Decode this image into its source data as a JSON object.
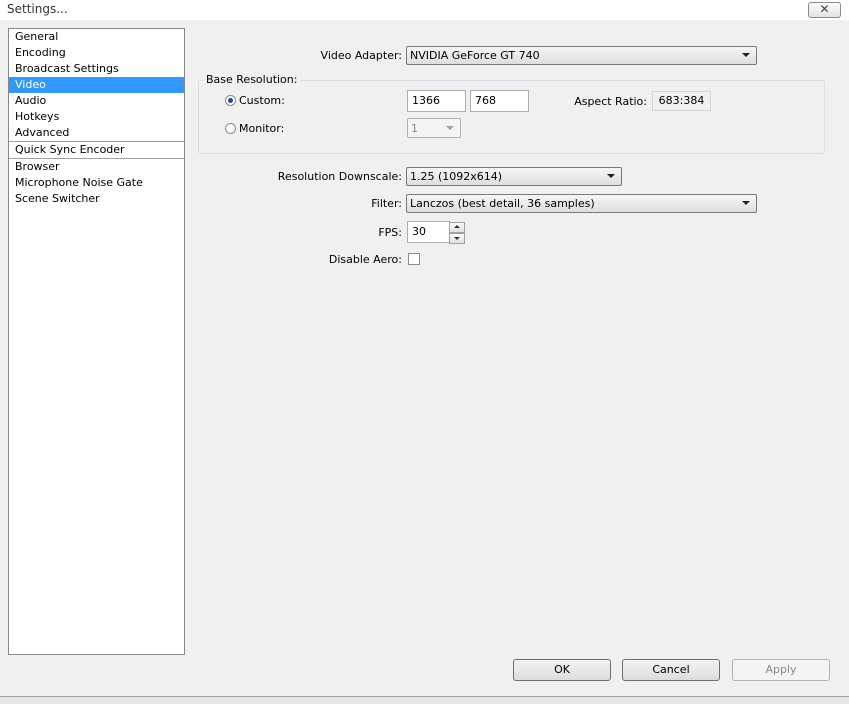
{
  "window": {
    "title": "Settings..."
  },
  "sidebar": {
    "items": [
      {
        "label": "General"
      },
      {
        "label": "Encoding"
      },
      {
        "label": "Broadcast Settings"
      },
      {
        "label": "Video",
        "selected": true
      },
      {
        "label": "Audio"
      },
      {
        "label": "Hotkeys"
      },
      {
        "label": "Advanced"
      },
      {
        "label": "Quick Sync Encoder"
      },
      {
        "label": "Browser"
      },
      {
        "label": "Microphone Noise Gate"
      },
      {
        "label": "Scene Switcher"
      }
    ]
  },
  "video": {
    "adapter_label": "Video Adapter:",
    "adapter_value": "NVIDIA GeForce GT 740",
    "base_resolution_label": "Base Resolution:",
    "custom_label": "Custom:",
    "custom_width": "1366",
    "custom_height": "768",
    "aspect_ratio_label": "Aspect Ratio:",
    "aspect_ratio_value": "683:384",
    "monitor_label": "Monitor:",
    "monitor_value": "1",
    "downscale_label": "Resolution Downscale:",
    "downscale_value": "1.25  (1092x614)",
    "filter_label": "Filter:",
    "filter_value": "Lanczos (best detail, 36 samples)",
    "fps_label": "FPS:",
    "fps_value": "30",
    "disable_aero_label": "Disable Aero:"
  },
  "buttons": {
    "ok": "OK",
    "cancel": "Cancel",
    "apply": "Apply"
  },
  "colors": {
    "selection": "#3399ff",
    "background": "#f0f0f0"
  }
}
